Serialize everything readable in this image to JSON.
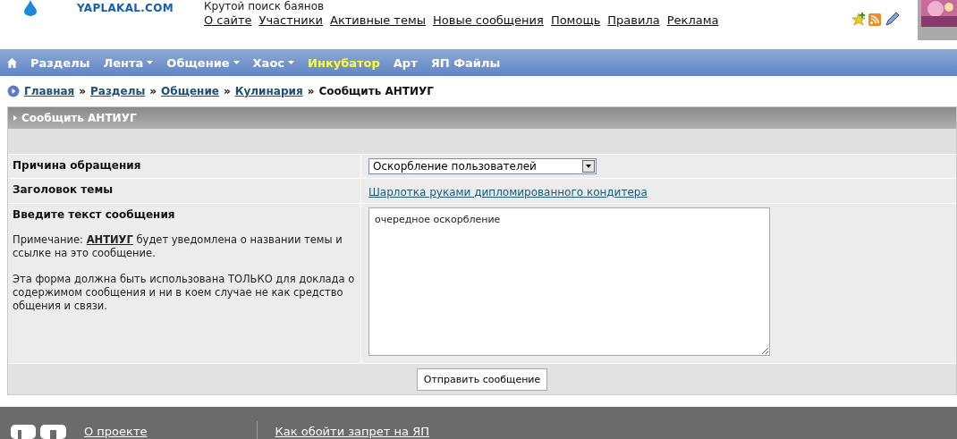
{
  "header": {
    "logo_text": "YAPLAKAL.COM",
    "tagline": "Крутой поиск баянов",
    "links": [
      "О сайте",
      "Участники",
      "Активные темы",
      "Новые сообщения",
      "Помощь",
      "Правила",
      "Реклама"
    ]
  },
  "nav": [
    {
      "label": "Разделы",
      "dropdown": false,
      "highlight": false
    },
    {
      "label": "Лента",
      "dropdown": true,
      "highlight": false
    },
    {
      "label": "Общение",
      "dropdown": true,
      "highlight": false
    },
    {
      "label": "Хаос",
      "dropdown": true,
      "highlight": false
    },
    {
      "label": "Инкубатор",
      "dropdown": false,
      "highlight": true
    },
    {
      "label": "Арт",
      "dropdown": false,
      "highlight": false
    },
    {
      "label": "ЯП Файлы",
      "dropdown": false,
      "highlight": false
    }
  ],
  "breadcrumb": {
    "links": [
      "Главная",
      "Разделы",
      "Общение",
      "Кулинария"
    ],
    "separator": "»",
    "current": "Сообщить АНТИУГ"
  },
  "panel": {
    "title": "Сообщить АНТИУГ",
    "reason": {
      "label": "Причина обращения",
      "value": "Оскорбление пользователей"
    },
    "topic": {
      "label": "Заголовок темы",
      "value": "Шарлотка руками дипломированного кондитера"
    },
    "message": {
      "label": "Введите текст сообщения",
      "note": "Примечание: **АНТИУГ** будет уведомлена о названии темы и ссылке на это сообщение.",
      "warning": "Эта форма должна быть использована ТОЛЬКО для доклада о содержимом сообщения и ни в коем случае не как средство общения и связи.",
      "value": "очередное оскорбление"
    },
    "submit": "Отправить сообщение"
  },
  "footer": {
    "links": [
      "О проекте",
      "Как обойти запрет на ЯП"
    ]
  }
}
